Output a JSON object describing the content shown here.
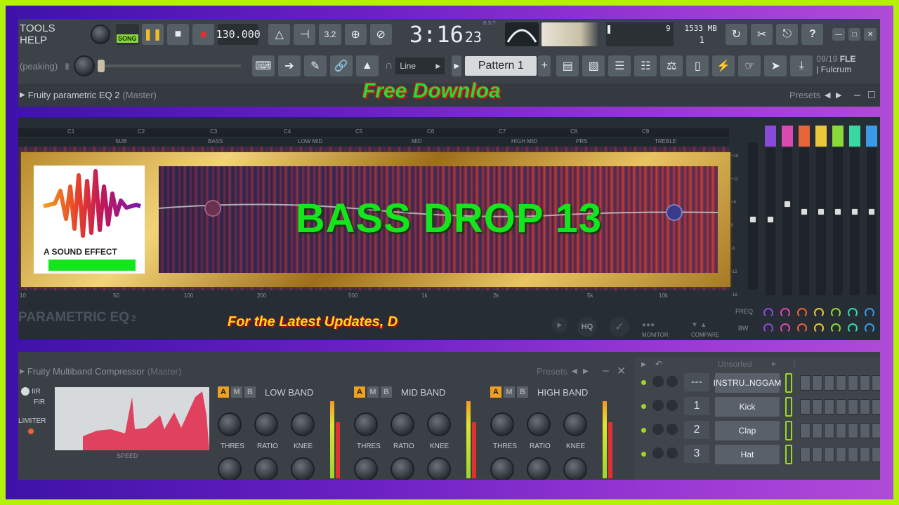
{
  "toolbar": {
    "menu_text": "TOOLS HELP",
    "song_label": "SONG",
    "tempo": "130.000",
    "time_main": "3:16",
    "time_sub": "23",
    "time_bst": "B:S:T",
    "cpu_value": "9",
    "memory": "1533 MB",
    "poly": "1",
    "hint_text": "(peaking)",
    "snap_mode": "Line",
    "pattern": "Pattern 1",
    "news_date": "09/19",
    "news_title": "FLE",
    "news_sub": "| Fulcrum",
    "plugin_title": "Fruity parametric EQ 2",
    "plugin_target": "(Master)",
    "presets": "Presets"
  },
  "promo": {
    "top_text": "Free Downloa",
    "bottom_text": "For the Latest Updates, D"
  },
  "eq": {
    "note_labels": [
      "C1",
      "C2",
      "C3",
      "C4",
      "C5",
      "C6",
      "C7",
      "C8",
      "C9"
    ],
    "band_labels": [
      "SUB",
      "BASS",
      "LOW MID",
      "MID",
      "HIGH MID",
      "PRS",
      "TREBLE"
    ],
    "freq_labels": [
      "10",
      "50",
      "100",
      "200",
      "500",
      "1k",
      "2k",
      "5k",
      "10k"
    ],
    "db_labels": [
      "+18",
      "+12",
      "+6",
      "0",
      "-6",
      "-12",
      "-18"
    ],
    "title": "PARAMETRIC EQ",
    "title_sub": "2",
    "monitor": "MONITOR",
    "compare": "COMPARE",
    "hq": "HQ",
    "freq_label": "FREQ",
    "bw_label": "BW",
    "band_colors": [
      "#8a4ad8",
      "#d84ab0",
      "#e8643a",
      "#e8c83a",
      "#8ad83a",
      "#3ad8a0",
      "#3a9ae8"
    ]
  },
  "headline": {
    "title": "BASS DROP 13",
    "logo_text": "A SOUND EFFECT"
  },
  "compressor": {
    "title": "Fruity Multiband Compressor",
    "target": "(Master)",
    "presets": "Presets",
    "iir": "IIR",
    "fir": "FIR",
    "limiter": "LIMITER",
    "speed": "SPEED",
    "bands": [
      "LOW BAND",
      "MID BAND",
      "HIGH BAND"
    ],
    "knob_labels": [
      "THRES",
      "RATIO",
      "KNEE"
    ],
    "ab_labels": [
      "A",
      "M",
      "B"
    ]
  },
  "channel_rack": {
    "filter": "Unsorted",
    "channels": [
      {
        "num": "---",
        "name": "INSTRU..NGGAM"
      },
      {
        "num": "1",
        "name": "Kick"
      },
      {
        "num": "2",
        "name": "Clap"
      },
      {
        "num": "3",
        "name": "Hat"
      }
    ]
  }
}
